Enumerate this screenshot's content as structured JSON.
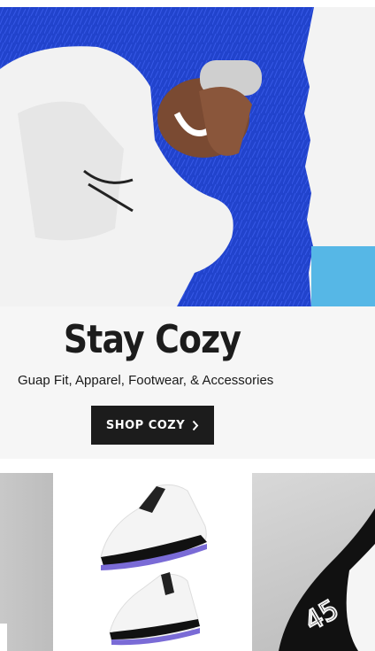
{
  "hero": {
    "image_icon": "person-in-white-hoodie-on-blue-fur-photo"
  },
  "promo": {
    "title": "Stay Cozy",
    "subtitle": "Guap Fit, Apparel, Footwear, & Accessories",
    "button_label": "SHOP COZY",
    "button_icon": "chevron-right-icon"
  },
  "products": [
    {
      "image_icon": "gray-product-photo"
    },
    {
      "image_icon": "black-white-sneakers-photo"
    },
    {
      "image_icon": "sneaker-closeup-45-photo"
    }
  ],
  "colors": {
    "button_bg": "#1c1c1c",
    "panel_bg": "#f6f6f6",
    "hero_blue": "#1f3fc7"
  }
}
